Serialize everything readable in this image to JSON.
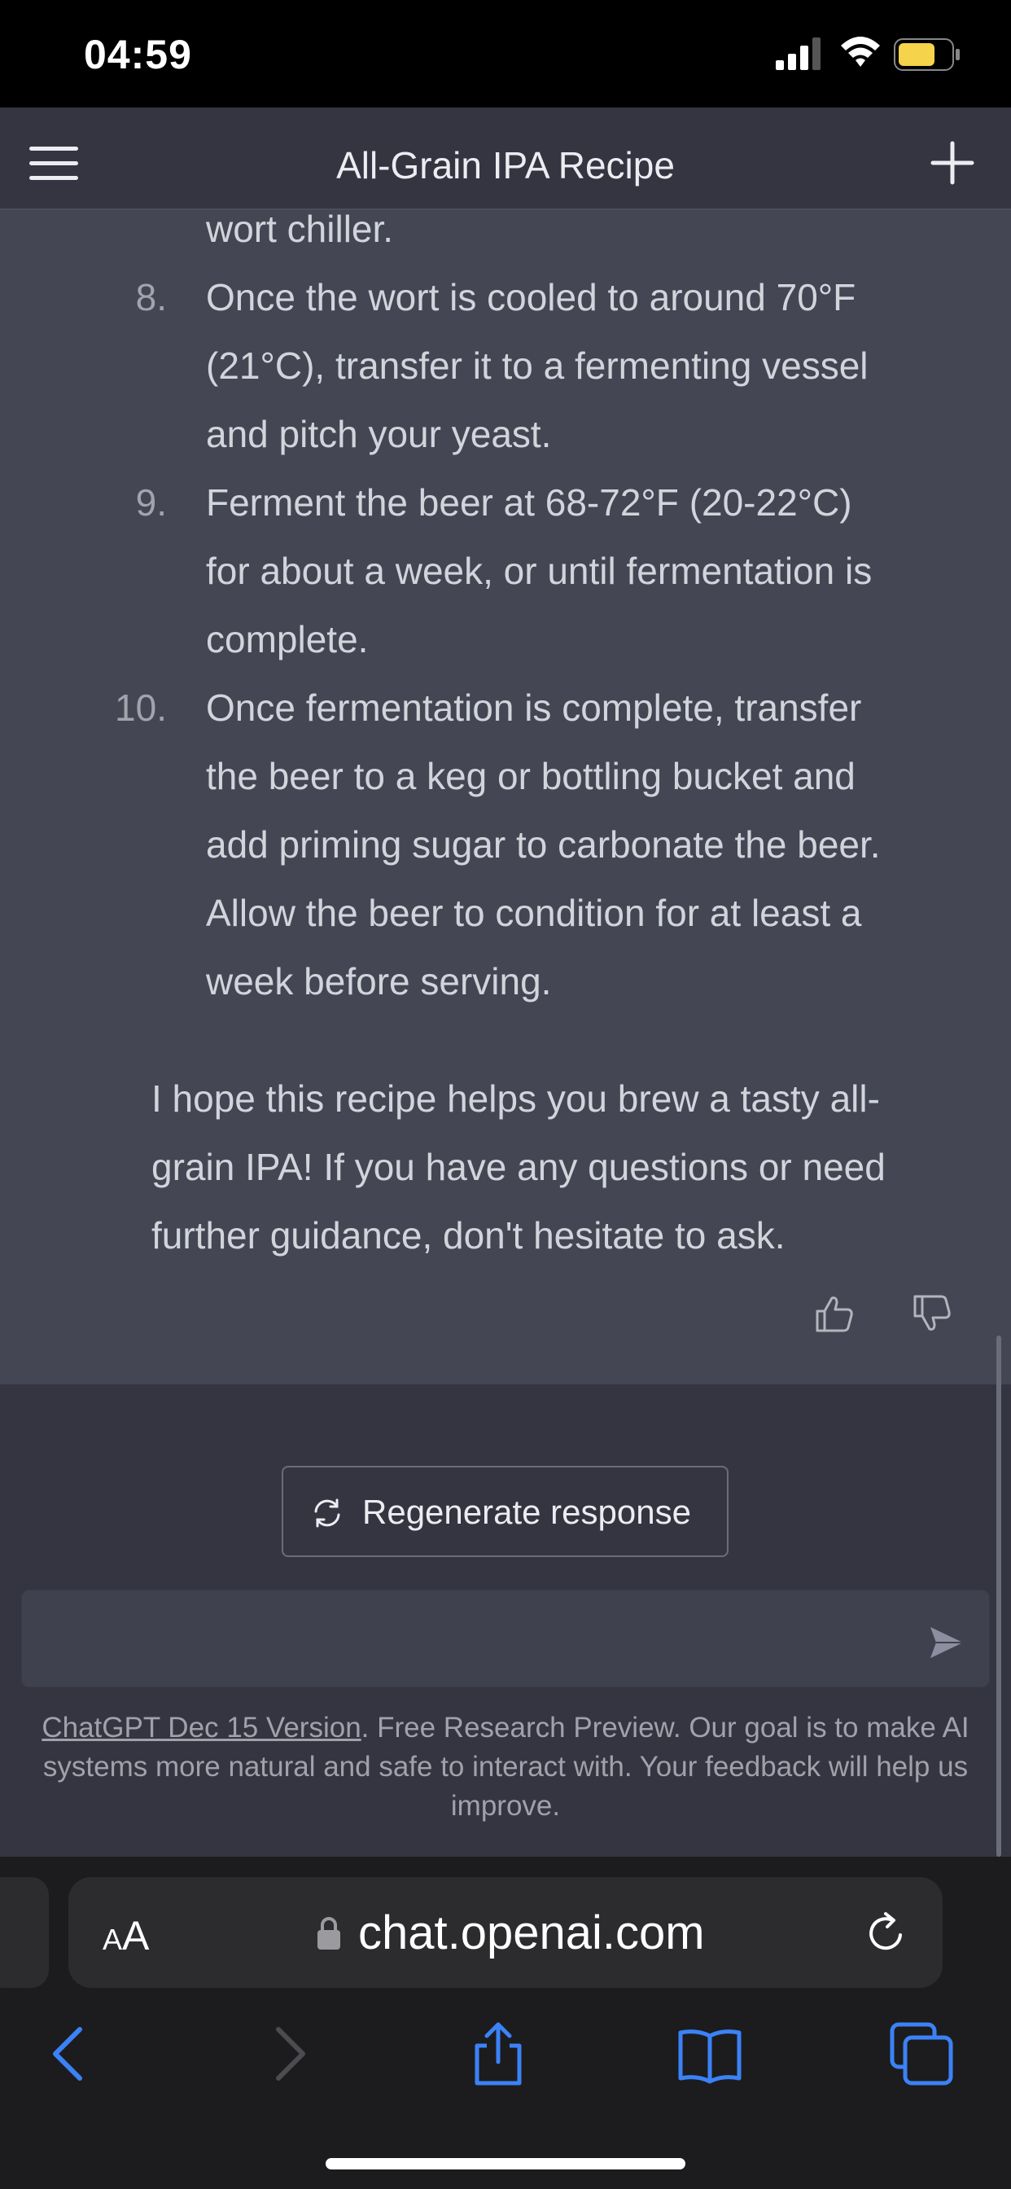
{
  "status_bar": {
    "time": "04:59",
    "signal_icon": "cellular-signal-icon",
    "wifi_icon": "wifi-icon",
    "battery_icon": "battery-icon",
    "battery_color": "#f5d34a"
  },
  "header": {
    "title": "All-Grain IPA Recipe",
    "menu_icon": "hamburger-menu-icon",
    "new_chat_icon": "plus-icon"
  },
  "message": {
    "continued_text": "wort chiller.",
    "steps": [
      {
        "number": "8.",
        "lines": [
          "Once the wort is cooled to around 70°F",
          "(21°C), transfer it to a fermenting vessel",
          "and pitch your yeast."
        ]
      },
      {
        "number": "9.",
        "lines": [
          "Ferment the beer at 68-72°F (20-22°C)",
          "for about a week, or until fermentation is",
          "complete."
        ]
      },
      {
        "number": "10.",
        "lines": [
          "Once fermentation is complete, transfer",
          "the beer to a keg or bottling bucket and",
          "add priming sugar to carbonate the beer.",
          "Allow the beer to condition for at least a",
          "week before serving."
        ]
      }
    ],
    "closing_lines": [
      "I hope this recipe helps you brew a tasty all-",
      "grain IPA! If you have any questions or need",
      "further guidance, don't hesitate to ask."
    ],
    "feedback_icons": [
      "thumbs-up-icon",
      "thumbs-down-icon"
    ]
  },
  "composer": {
    "regenerate_label": "Regenerate response",
    "input_value": "",
    "send_icon": "send-icon"
  },
  "disclaimer": {
    "link_text": "ChatGPT Dec 15 Version",
    "text": ". Free Research Preview. Our goal is to make AI systems more natural and safe to interact with. Your feedback will help us improve."
  },
  "browser": {
    "text_size_label_big": "A",
    "text_size_label_small": "A",
    "url": "chat.openai.com",
    "toolbar_icons": [
      "back-icon",
      "forward-icon",
      "share-icon",
      "bookmarks-icon",
      "tabs-icon"
    ],
    "accent_color": "#3b82f6"
  },
  "colors": {
    "message_background": "#444654",
    "page_background": "#343541",
    "header_background": "#343541"
  }
}
